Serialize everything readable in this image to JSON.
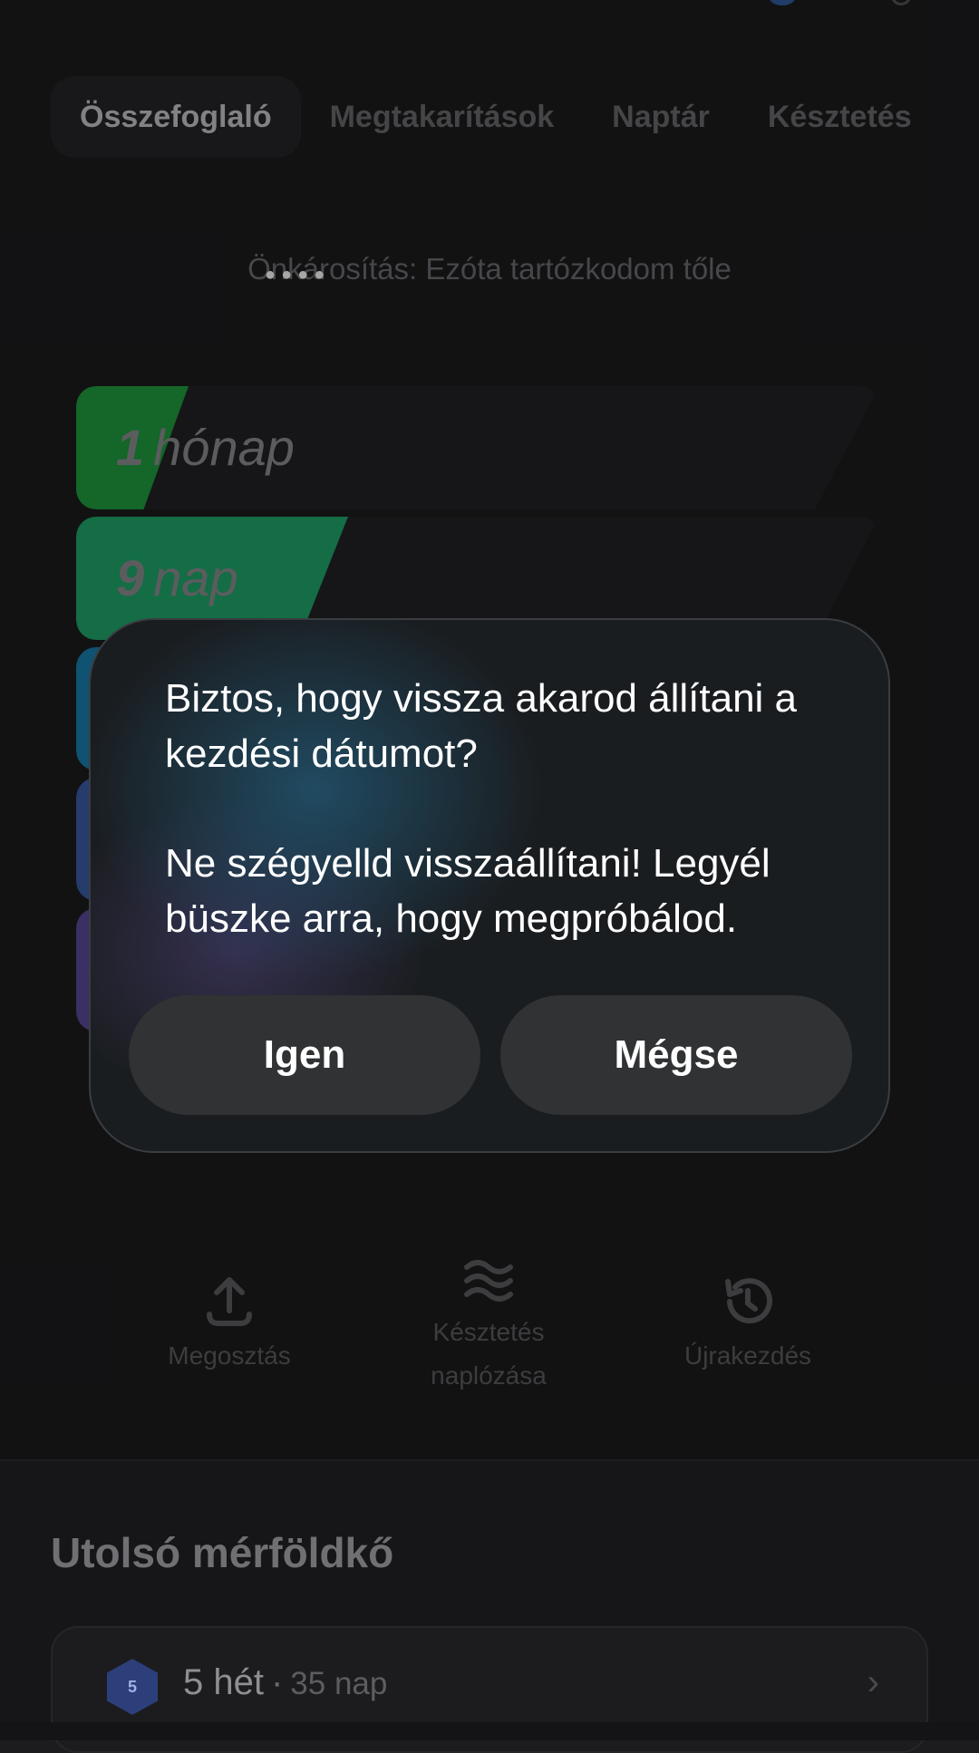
{
  "tabs": [
    {
      "label": "Összefoglaló",
      "active": true
    },
    {
      "label": "Megtakarítások",
      "active": false
    },
    {
      "label": "Naptár",
      "active": false
    },
    {
      "label": "Késztetés",
      "active": false
    }
  ],
  "subtitle": "Önkárosítás: Ezóta tartózkodom tőle",
  "progress": [
    {
      "value": "1",
      "unit": "hónap",
      "color": "#1f9d3f",
      "fill_percent": 12
    },
    {
      "value": "9",
      "unit": "nap",
      "color": "#1fa86a",
      "fill_percent": 28
    },
    {
      "value": "",
      "unit": "",
      "color": "#1a7fb0",
      "fill_percent": 4
    },
    {
      "value": "",
      "unit": "",
      "color": "#3a5ca8",
      "fill_percent": 4
    },
    {
      "value": "",
      "unit": "",
      "color": "#5a4b98",
      "fill_percent": 4
    }
  ],
  "dialog": {
    "question": "Biztos, hogy vissza akarod állítani a kezdési dátumot?",
    "encouragement": "Ne szégyelld visszaállítani! Legyél büszke arra, hogy megpróbálod.",
    "yes_label": "Igen",
    "no_label": "Mégse"
  },
  "actions": [
    {
      "label": "Megosztás",
      "icon": "share-upload-icon"
    },
    {
      "label": "Késztetés naplózása",
      "icon": "waves-icon"
    },
    {
      "label": "Újrakezdés",
      "icon": "history-reset-icon"
    }
  ],
  "milestone_section": {
    "title": "Utolsó mérföldkő",
    "badge": "5",
    "name": "5 hét",
    "separator": "·",
    "detail": "35 nap"
  }
}
